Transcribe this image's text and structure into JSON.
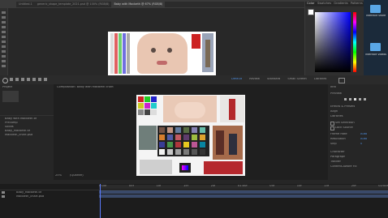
{
  "photoshop": {
    "tabs": [
      "Untitled-1",
      "generic_shape_template_2021.psd @ 100% (RGB/8)",
      "Baby with Macbeth @ 67% (RGB/8)"
    ],
    "panel_tabs": [
      "Color",
      "Swatches",
      "Gradients",
      "Patterns"
    ],
    "desktop_items": [
      "Interface share",
      "Interface Videos"
    ]
  },
  "after_effects": {
    "menu_items": [
      "Default",
      "Review",
      "Standard",
      "Small Screen",
      "Libraries"
    ],
    "project_panel": {
      "title": "Project",
      "items": [
        "Baby with Macbeth.tif",
        "Precomp",
        "Solids",
        "Baby_Macbeth.tif",
        "Macbeth_chart.psd"
      ]
    },
    "comp_panel": {
      "title": "Composition: Baby with Macbeth chart",
      "zoom": "25%",
      "resolution": "(Quarter)"
    },
    "right_panel": {
      "title": "Info",
      "sections": [
        "Preview",
        "Effects & Presets",
        "Align",
        "Libraries",
        "Character",
        "Paragraph",
        "Tracker",
        "Content-Aware Fill"
      ],
      "checkboxes": [
        "Set Selection",
        "Lock Source"
      ],
      "fields": [
        {
          "label": "Frame Rate",
          "value": "Auto"
        },
        {
          "label": "Resolution",
          "value": "Auto"
        },
        {
          "label": "Skip",
          "value": "0"
        }
      ]
    },
    "timeline": {
      "layers": [
        "Baby_Macbeth.tif",
        "Macbeth_chart.psd"
      ],
      "ruler": [
        "0:00f",
        "05f",
        "10f",
        "15f",
        "20f",
        "01:00f",
        "05f",
        "10f",
        "15f",
        "20f",
        "02:00f"
      ]
    }
  },
  "colors": {
    "accent_blue": "#4d8ee0",
    "playhead": "#5b7cff"
  }
}
